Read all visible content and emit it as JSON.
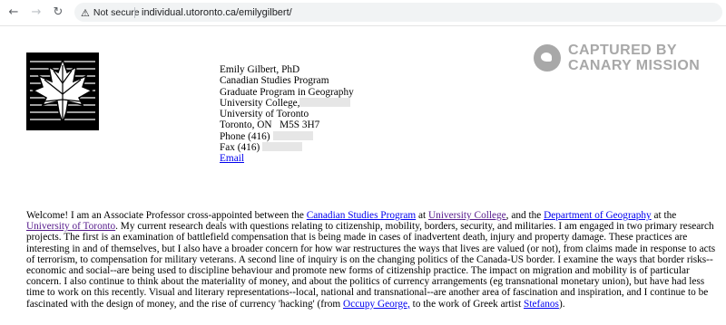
{
  "browser": {
    "security_label": "Not secure",
    "url": "individual.utoronto.ca/emilygilbert/"
  },
  "watermark": {
    "line1": "CAPTURED BY",
    "line2": "CANARY MISSION"
  },
  "contact": {
    "name": "Emily Gilbert, PhD",
    "program": "Canadian Studies Program",
    "grad_program": "Graduate Program in Geography",
    "college": "University College,",
    "university": "University of Toronto",
    "city": "Toronto, ON",
    "postal": "M5S 3H7",
    "phone": "Phone (416)",
    "fax": "Fax (416)",
    "email_link": "Email"
  },
  "bio": {
    "t1": "Welcome! I am an Associate Professor cross-appointed between the ",
    "l1": "Canadian Studies Program",
    "t2": " at ",
    "l2": "University College",
    "t3": ", and the ",
    "l3": "Department of Geography",
    "t4": " at the ",
    "l4": "University of Toronto",
    "t5": ". My current research deals with questions relating to citizenship, mobility, borders, security, and militaries. I am engaged in two primary research projects. The first is an examination of battlefield compensation that is being made in cases of inadvertent death, injury and property damage. These practices are interesting in and of themselves, but I also have a broader concern for how war restructures the ways that lives are valued (or not), from claims made in response to acts of terrorism, to compensation for military veterans. A second line of inquiry is on the changing politics of the Canada-US border. I examine the ways that border risks--economic and social--are being used to discipline behaviour and promote new forms of citizenship practice. The impact on migration and mobility is of particular concern. I also continue to think about the materiality of money, and about the politics of currency arrangements (eg transnational monetary union), but have had less time to work on this recently. Visual and literary representations--local, national and transnational--are another area of fascination and inspiration, and I continue to be fascinated with the design of money, and the rise of currency 'hacking' (from ",
    "l5": "Occupy George,",
    "t6": " to the work of Greek artist ",
    "l6": "Stefanos",
    "t7": ")."
  }
}
